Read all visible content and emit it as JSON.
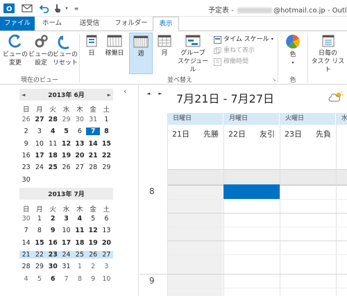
{
  "window": {
    "title_prefix": "予定表 - ",
    "title_suffix": "@hotmail.co.jp - Outlo"
  },
  "qat": {
    "icons": [
      "outlook-logo-icon",
      "send-receive-icon",
      "undo-icon",
      "touch-mode-icon",
      "customize-icon"
    ]
  },
  "tabs": [
    "ファイル",
    "ホーム",
    "送受信",
    "フォルダー",
    "表示"
  ],
  "ribbon": {
    "view_change": "ビューの\n変更",
    "view_settings": "ビューの\n設定",
    "view_reset": "ビューの\nリセット",
    "group_current_view": "現在のビュー",
    "day": "日",
    "work_week": "稼働日",
    "week": "週",
    "month": "月",
    "group_schedule": "グループ\nスケジュール",
    "timescale": "タイム スケール",
    "overlay": "重ねて表示",
    "work_hours": "稼働時間",
    "group_arrange": "並べ替え",
    "color": "色",
    "group_color": "色",
    "daily_tasks": "日毎の\nタスク リスト",
    "colors": {
      "accent": "#0072c6",
      "selected_bg": "#cde6f7"
    }
  },
  "mini_calendars": [
    {
      "title": "2013年 6月",
      "dow": [
        "日",
        "月",
        "火",
        "水",
        "木",
        "金",
        "土"
      ],
      "weeks": [
        [
          [
            "26",
            "o"
          ],
          [
            "27",
            "b"
          ],
          [
            "28",
            "b"
          ],
          [
            "29",
            "o"
          ],
          [
            "30",
            "o"
          ],
          [
            "31",
            "o"
          ],
          [
            "1",
            "n"
          ]
        ],
        [
          [
            "2",
            "n"
          ],
          [
            "3",
            "n"
          ],
          [
            "4",
            "b"
          ],
          [
            "5",
            "b"
          ],
          [
            "6",
            "n"
          ],
          [
            "7",
            "t"
          ],
          [
            "8",
            "b"
          ]
        ],
        [
          [
            "9",
            "n"
          ],
          [
            "10",
            "n"
          ],
          [
            "11",
            "n"
          ],
          [
            "12",
            "b"
          ],
          [
            "13",
            "b"
          ],
          [
            "14",
            "b"
          ],
          [
            "15",
            "b"
          ]
        ],
        [
          [
            "16",
            "n"
          ],
          [
            "17",
            "b"
          ],
          [
            "18",
            "b"
          ],
          [
            "19",
            "b"
          ],
          [
            "20",
            "b"
          ],
          [
            "21",
            "b"
          ],
          [
            "22",
            "b"
          ]
        ],
        [
          [
            "23",
            "n"
          ],
          [
            "24",
            "n"
          ],
          [
            "25",
            "b"
          ],
          [
            "26",
            "n"
          ],
          [
            "27",
            "n"
          ],
          [
            "28",
            "n"
          ],
          [
            "29",
            "n"
          ]
        ],
        [
          [
            "30",
            "n"
          ]
        ]
      ],
      "prev": "◄",
      "next": "►"
    },
    {
      "title": "2013年 7月",
      "dow": [
        "日",
        "月",
        "火",
        "水",
        "木",
        "金",
        "土"
      ],
      "weeks": [
        [
          [
            "30",
            "o"
          ],
          [
            "1",
            "n"
          ],
          [
            "2",
            "b"
          ],
          [
            "3",
            "b"
          ],
          [
            "4",
            "b"
          ],
          [
            "5",
            "n"
          ],
          [
            "6",
            "n"
          ]
        ],
        [
          [
            "7",
            "n"
          ],
          [
            "8",
            "n"
          ],
          [
            "9",
            "b"
          ],
          [
            "10",
            "n"
          ],
          [
            "11",
            "b"
          ],
          [
            "12",
            "b"
          ],
          [
            "13",
            "n"
          ]
        ],
        [
          [
            "14",
            "n"
          ],
          [
            "15",
            "b"
          ],
          [
            "16",
            "b"
          ],
          [
            "17",
            "b"
          ],
          [
            "18",
            "b"
          ],
          [
            "19",
            "b"
          ],
          [
            "20",
            "b"
          ]
        ],
        [
          [
            "21",
            "n"
          ],
          [
            "22",
            "n"
          ],
          [
            "23",
            "b"
          ],
          [
            "24",
            "n"
          ],
          [
            "25",
            "n"
          ],
          [
            "26",
            "n"
          ],
          [
            "27",
            "n"
          ]
        ],
        [
          [
            "28",
            "n"
          ],
          [
            "29",
            "n"
          ],
          [
            "30",
            "b"
          ],
          [
            "31",
            "n"
          ],
          [
            "1",
            "o"
          ],
          [
            "2",
            "o"
          ],
          [
            "3",
            "o"
          ]
        ],
        [
          [
            "4",
            "o"
          ],
          [
            "5",
            "o"
          ],
          [
            "6",
            "b"
          ],
          [
            "7",
            "o"
          ],
          [
            "8",
            "o"
          ],
          [
            "9",
            "o"
          ],
          [
            "10",
            "o"
          ]
        ]
      ],
      "selected_week": 3
    }
  ],
  "calendar": {
    "range": "7月21日 - 7月27日",
    "days": [
      {
        "dow": "日曜日",
        "date": "21日",
        "rokuyo": "先勝"
      },
      {
        "dow": "月曜日",
        "date": "22日",
        "rokuyo": "友引"
      },
      {
        "dow": "火曜日",
        "date": "23日",
        "rokuyo": "先負"
      },
      {
        "dow": "水",
        "date": "",
        "rokuyo": ""
      }
    ],
    "hours": [
      "8",
      "9"
    ],
    "collapse_glyph": "‹"
  }
}
